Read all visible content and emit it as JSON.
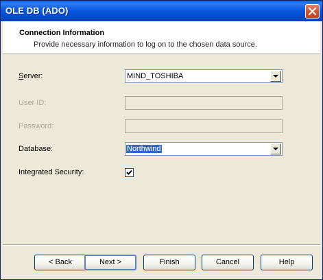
{
  "window": {
    "title": "OLE DB (ADO)"
  },
  "header": {
    "title": "Connection Information",
    "subtitle": "Provide necessary information to log on to the chosen data source."
  },
  "fields": {
    "server": {
      "label": "Server:",
      "value": "MIND_TOSHIBA"
    },
    "user_id": {
      "label": "User ID:",
      "value": ""
    },
    "password": {
      "label": "Password:",
      "value": ""
    },
    "database": {
      "label": "Database:",
      "value": "Northwind"
    },
    "integrated_security": {
      "label": "Integrated Security:",
      "checked": true
    }
  },
  "buttons": {
    "back": "< Back",
    "next": "Next >",
    "finish": "Finish",
    "cancel": "Cancel",
    "help": "Help"
  },
  "colors": {
    "titlebar": "#0a5ae0",
    "close_button": "#d5542f",
    "selection": "#316ac5",
    "dialog_bg": "#ece9d8"
  },
  "icons": {
    "close": "close-icon",
    "dropdown": "chevron-down-icon",
    "check": "checkmark-icon"
  }
}
